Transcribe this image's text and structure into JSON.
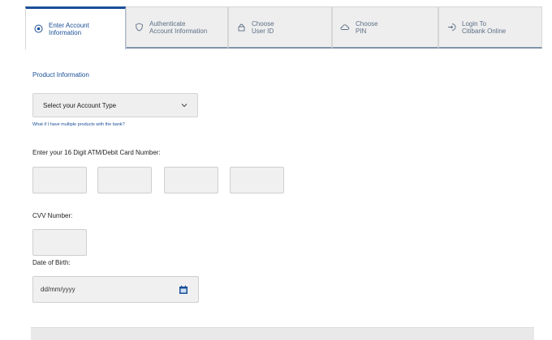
{
  "stepper": {
    "steps": [
      {
        "line1": "Enter Account",
        "line2": "Information",
        "icon": "target-icon",
        "active": true
      },
      {
        "line1": "Authenticate",
        "line2": "Account Information",
        "icon": "shield-icon",
        "active": false
      },
      {
        "line1": "Choose",
        "line2": "User ID",
        "icon": "lock-icon",
        "active": false
      },
      {
        "line1": "Choose",
        "line2": "PIN",
        "icon": "cloud-icon",
        "active": false
      },
      {
        "line1": "Login To",
        "line2": "Citibank Online",
        "icon": "login-icon",
        "active": false
      }
    ]
  },
  "form": {
    "product_heading": "Product Information",
    "account_type_placeholder": "Select your Account Type",
    "multiple_products_link": "What if I have multiple products with the bank?",
    "card_number_label": "Enter your 16 Digit ATM/Debit Card Number:",
    "cvv_label": "CVV Number:",
    "dob_label": "Date of Birth:",
    "dob_placeholder": "dd/mm/yyyy"
  },
  "colors": {
    "brand_blue": "#1a4f97",
    "step_text": "#5c6f86"
  }
}
